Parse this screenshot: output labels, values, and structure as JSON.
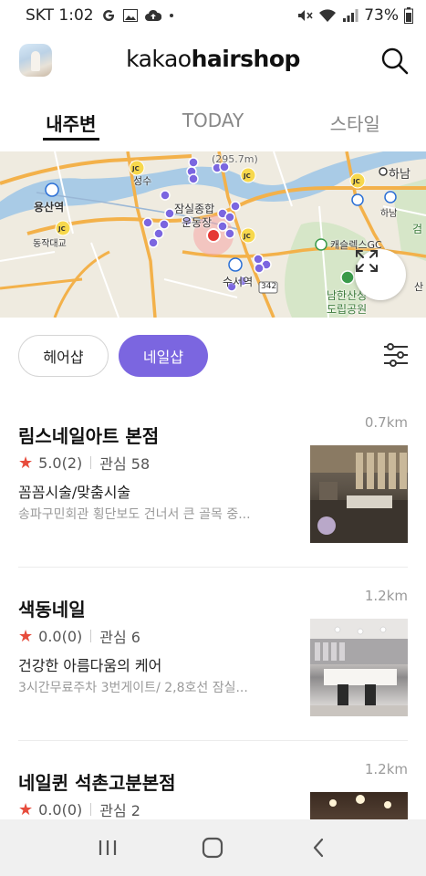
{
  "status_bar": {
    "carrier_time": "SKT 1:02",
    "battery": "73%"
  },
  "header": {
    "logo_light": "kakao",
    "logo_bold": "hairshop"
  },
  "tabs": [
    {
      "label": "내주변",
      "active": true
    },
    {
      "label": "TODAY",
      "active": false
    },
    {
      "label": "스타일",
      "active": false
    }
  ],
  "map": {
    "labels": {
      "yongsan": "용산역",
      "dongjak": "동작대교",
      "jamsil": "잠실종합",
      "undong": "운동장",
      "seongsu": "성수",
      "suseo": "수서역",
      "hanam": "하남",
      "hanam2": "하남",
      "road": "(295.7m)",
      "castle": "캐슬렉스GC",
      "namhan1": "남한산성",
      "namhan2": "도립공원",
      "route": "342",
      "gum": "검",
      "san": "산"
    }
  },
  "filters": {
    "hair_label": "헤어샵",
    "nail_label": "네일샵",
    "active_color": "#7b66e0"
  },
  "shops": [
    {
      "name": "림스네일아트 본점",
      "distance": "0.7km",
      "rating": "5.0(2)",
      "interest": "관심 58",
      "tagline": "꼼꼼시술/맞춤시술",
      "address": "송파구민회관 횡단보도 건너서 큰 골목 중..."
    },
    {
      "name": "색동네일",
      "distance": "1.2km",
      "rating": "0.0(0)",
      "interest": "관심 6",
      "tagline": "건강한 아름다움의 케어",
      "address": "3시간무료주차 3번게이트/ 2,8호선 잠실..."
    },
    {
      "name": "네일퀸 석촌고분본점",
      "distance": "1.2km",
      "rating": "0.0(0)",
      "interest": "관심 2",
      "tagline": "",
      "address": ""
    }
  ],
  "colors": {
    "accent": "#7b66e0",
    "star": "#e74c3c",
    "marker": "#7b66e0",
    "current": "#e53935"
  },
  "icons": {
    "search": "search-icon",
    "expand": "expand-icon",
    "filter": "filter-sliders-icon",
    "star": "star-icon"
  }
}
